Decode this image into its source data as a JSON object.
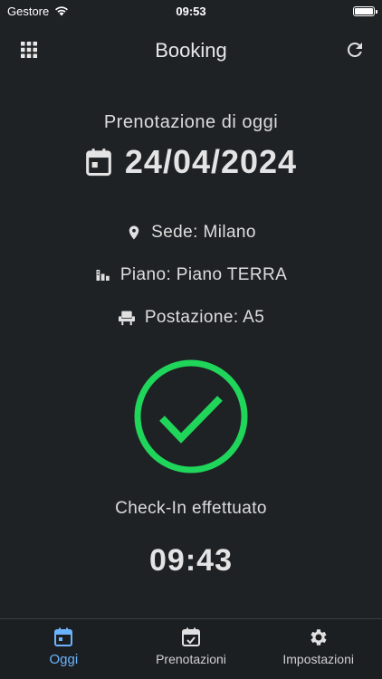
{
  "status_bar": {
    "carrier": "Gestore",
    "time": "09:53"
  },
  "header": {
    "title": "Booking"
  },
  "booking": {
    "subtitle": "Prenotazione di oggi",
    "date": "24/04/2024",
    "sede": "Sede: Milano",
    "piano": "Piano: Piano TERRA",
    "postazione": "Postazione: A5",
    "status": "Check-In effettuato",
    "checkin_time": "09:43"
  },
  "tabs": [
    {
      "label": "Oggi",
      "icon": "calendar-today-icon"
    },
    {
      "label": "Prenotazioni",
      "icon": "calendar-check-icon"
    },
    {
      "label": "Impostazioni",
      "icon": "gear-icon"
    }
  ],
  "colors": {
    "accent": "#6ab4ff",
    "success": "#1fd65b",
    "background": "#1f2225"
  }
}
